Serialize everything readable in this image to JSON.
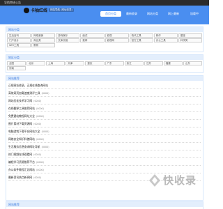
{
  "topbar": {
    "text": "导航审核公告"
  },
  "brand": {
    "name": "卡柚红线",
    "badge": "网站导航 (网址收录)"
  },
  "nav": {
    "items": [
      "首页分类",
      "最新收录",
      "网站分类",
      "网上最新",
      "加载中"
    ]
  },
  "section1": {
    "title": "网站分类",
    "tags": [
      "生活百科",
      "网络营销",
      "游戏娱乐",
      "面试",
      "影视",
      "快讯工具",
      "新作",
      "星座",
      "门户设计",
      "商业类",
      "文库文稿",
      "推荐",
      "影视网",
      "官方工具",
      "办公工具",
      "科学类",
      "WiFi工具",
      "教育"
    ]
  },
  "section2": {
    "title": "地区分类",
    "tags": [
      "全国",
      "北京",
      "上海",
      "天津",
      "重庆",
      "广东",
      "浙江",
      "江苏",
      "福建",
      "山东",
      "河南"
    ]
  },
  "section3": {
    "title": "网站推荐",
    "items": [
      {
        "title": "正规网址收录，正规在线查询网站",
        "meta": ""
      },
      {
        "title": "高效网页加载速度测评工具",
        "meta": "(0000)"
      },
      {
        "title": "网站优化技术学习网",
        "meta": "(0000)"
      },
      {
        "title": "在线翻译工具推荐网站",
        "meta": "(0000)"
      },
      {
        "title": "免费建站教程网址大全",
        "meta": "(0000)"
      },
      {
        "title": "图片素材下载资源网",
        "meta": "(0000)"
      },
      {
        "title": "电脑游戏下载平台网站大全",
        "meta": "(0000)"
      },
      {
        "title": "网络安全知识科普网站",
        "meta": "(0000)"
      },
      {
        "title": "生活服务信息查询网址导航",
        "meta": "(0000)"
      },
      {
        "title": "热门视频在线观看网",
        "meta": "(0000)"
      },
      {
        "title": "编程学习资源推荐平台",
        "meta": "(0000)"
      },
      {
        "title": "办公软件教程汇总网站",
        "meta": "(0000)"
      },
      {
        "title": "最新资讯热点新闻网",
        "meta": "(0000)"
      }
    ]
  },
  "section4": {
    "title": "网站推荐",
    "items": [
      {
        "title": "网站收录查询在线平台",
        "meta": "(0000)"
      }
    ]
  },
  "watermark": {
    "text": "快收录"
  },
  "colors": {
    "accent": "#4a8ef0",
    "header_bg": "#2b2b2b",
    "section_head": "#e3eefc"
  }
}
